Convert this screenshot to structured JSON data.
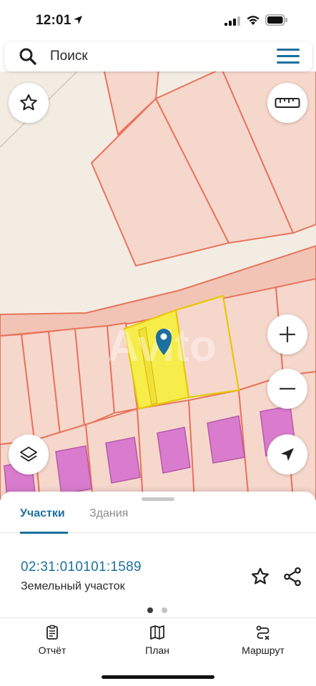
{
  "status_bar": {
    "time": "12:01"
  },
  "search": {
    "placeholder": "Поиск"
  },
  "map": {
    "watermark": "Avito",
    "colors": {
      "land": "#f3ece3",
      "parcel_fill": "#f6d7cc",
      "parcel_border": "#e8745c",
      "road": "#f1c4b6",
      "building": "#d97ccd",
      "selected": "#f6ec4a",
      "pin": "#1c6f9e"
    }
  },
  "sheet": {
    "tabs": [
      {
        "label": "Участки",
        "active": true
      },
      {
        "label": "Здания",
        "active": false
      }
    ],
    "cadastral_number": "02:31:010101:1589",
    "plot_type": "Земельный участок",
    "page_indicator": {
      "current": 1,
      "total": 2
    }
  },
  "bottom_nav": [
    {
      "label": "Отчёт",
      "icon": "report-icon"
    },
    {
      "label": "План",
      "icon": "map-icon"
    },
    {
      "label": "Маршрут",
      "icon": "route-icon"
    }
  ],
  "icons": {
    "favorite": "star-icon",
    "share": "share-icon",
    "layers": "layers-icon",
    "ruler": "ruler-icon",
    "locate": "navigation-arrow-icon"
  }
}
